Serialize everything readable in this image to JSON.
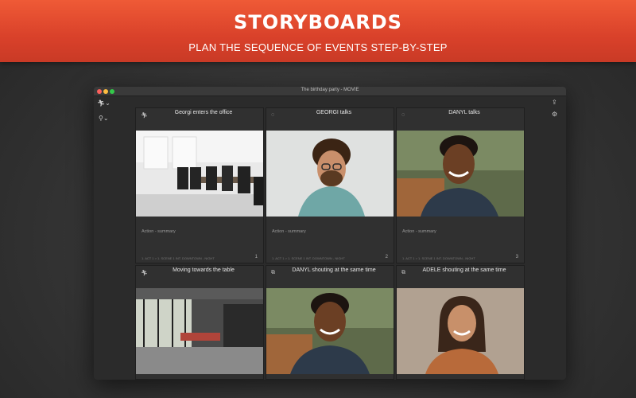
{
  "banner": {
    "title": "STORYBOARDS",
    "subtitle": "PLAN THE SEQUENCE OF EVENTS STEP-BY-STEP"
  },
  "window": {
    "title": "The birthday party - MOVIE"
  },
  "cards": [
    {
      "icon": "runner-icon",
      "title": "Georgi enters the office",
      "summary": "Action - summary",
      "meta": "1. ACT 1 > 1. SCENE 1 INT. DOWNTOWN - NIGHT",
      "number": "1",
      "image": "office meeting room"
    },
    {
      "icon": "speech-bubble-icon",
      "title": "GEORGI talks",
      "summary": "Action - summary",
      "meta": "1. ACT 1 > 1. SCENE 1 INT. DOWNTOWN - NIGHT",
      "number": "2",
      "image": "man with glasses"
    },
    {
      "icon": "speech-bubble-icon",
      "title": "DANYL talks",
      "summary": "Action - summary",
      "meta": "1. ACT 1 > 1. SCENE 1 INT. DOWNTOWN - NIGHT",
      "number": "3",
      "image": "smiling man outdoors"
    },
    {
      "icon": "runner-icon",
      "title": "Moving towards the table",
      "image": "large office"
    },
    {
      "icon": "dual-speech-icon",
      "title": "DANYL shouting at the same time",
      "image": "smiling man outdoors"
    },
    {
      "icon": "dual-speech-icon",
      "title": "ADELE shouting at the same time",
      "image": "smiling woman"
    }
  ],
  "colors": {
    "banner": "#e04a2e",
    "window_bg": "#2b2b2b",
    "card_bg": "#303030"
  }
}
